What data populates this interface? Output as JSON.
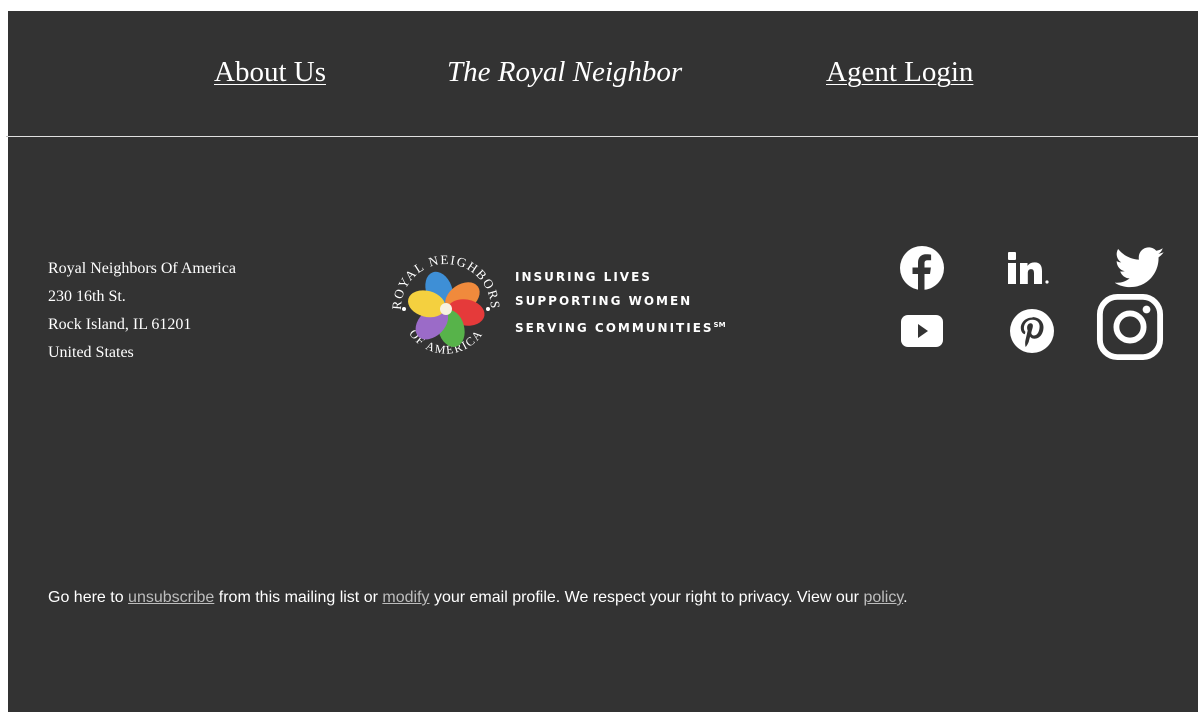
{
  "nav": {
    "about_label": "About Us",
    "royal_label": "The Royal Neighbor",
    "agent_label": "Agent Login"
  },
  "address": {
    "line1": "Royal Neighbors Of America",
    "line2": "230 16th St.",
    "line3": "Rock Island, IL 61201",
    "line4": "United States"
  },
  "logo": {
    "ring_top": "ROYAL NEIGHBORS",
    "ring_bottom": "OF AMERICA",
    "tagline": [
      "INSURING LIVES",
      "SUPPORTING WOMEN",
      "SERVING COMMUNITIES"
    ],
    "service_mark": "SM"
  },
  "social": [
    "facebook-icon",
    "linkedin-icon",
    "twitter-icon",
    "youtube-icon",
    "pinterest-icon",
    "instagram-icon"
  ],
  "footer": {
    "pre": "Go here to ",
    "unsubscribe": "unsubscribe",
    "mid1": " from this mailing list or ",
    "modify": "modify",
    "mid2": " your email profile. We respect your right to privacy. View our ",
    "policy": "policy",
    "end": "."
  },
  "colors": {
    "panel_bg": "#333333",
    "text": "#ffffff",
    "link_muted": "#bdbdbd"
  }
}
